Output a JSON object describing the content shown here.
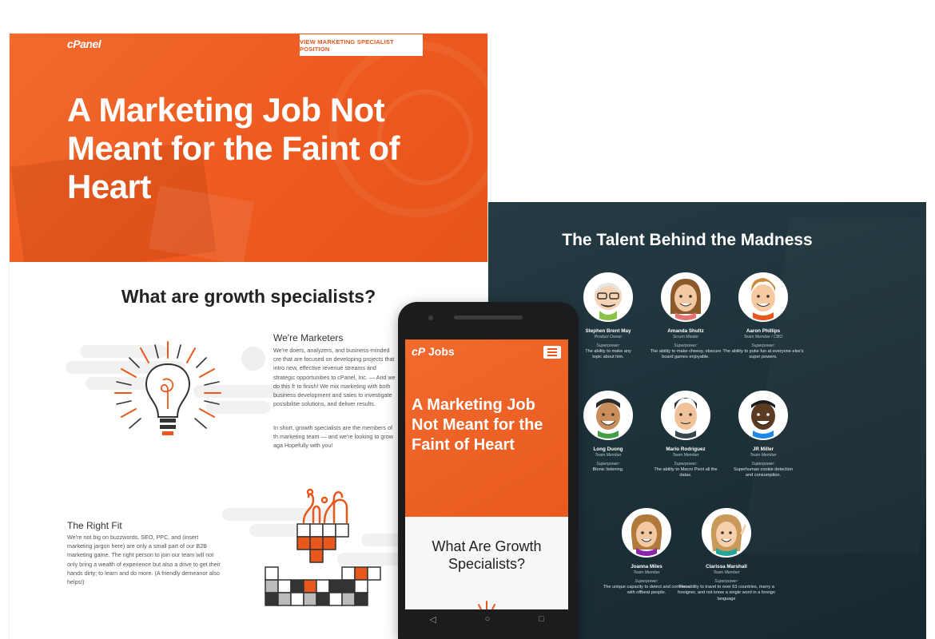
{
  "desktop": {
    "brand": "cPanel",
    "position_button": "VIEW MARKETING SPECIALIST POSITION",
    "hero_title": "A Marketing Job Not Meant for the Faint of Heart",
    "section_title": "What are growth specialists?",
    "marketers": {
      "heading": "We're Marketers",
      "paragraph1": "We're doers, analyzers, and business-minded cre that are focused on developing projects that intro new, effective revenue streams and strategic opportunities to cPanel, Inc. — And we do this fr to finish! We mix marketing with both business development and sales to investigate possibilitie solutions, and deliver results.",
      "paragraph2": "In short, growth specialists are the members of th marketing team — and we're looking to grow aga Hopefully with you!"
    },
    "right_fit": {
      "heading": "The Right Fit",
      "paragraph": "We're not big on buzzwords. SEO, PPC, and (insert marketing jargon here) are only a small part of our B2B marketing game. The right person to join our team will not only bring a wealth of experience but also a drive to get their hands dirty; to learn and do more. (A friendly demeanor also helps!)"
    },
    "accent_color": "#ee5a1f"
  },
  "talent": {
    "title": "The Talent Behind the Madness",
    "superpower_label": "Superpower:",
    "members": [
      {
        "name": "Stephen Brent May",
        "role": "Product Owner",
        "superpower": "The ability to make any topic about him."
      },
      {
        "name": "Amanda Shultz",
        "role": "Scrum Master",
        "superpower": "The ability to make cheesy, obscure board games enjoyable."
      },
      {
        "name": "Aaron Phillips",
        "role": "Team Member / CBO",
        "superpower": "The ability to poke fun at everyone else's super powers."
      },
      {
        "name": "Long Duong",
        "role": "Team Member",
        "superpower": "Bionic listening."
      },
      {
        "name": "Mario Rodriguez",
        "role": "Team Member",
        "superpower": "The ability to Macro Pivot all the datas."
      },
      {
        "name": "JR Miller",
        "role": "Team Member",
        "superpower": "Superhuman cookie detection and consumption."
      },
      {
        "name": "Joanna Miles",
        "role": "Team Member",
        "superpower": "The unique capacity to detect and converse with offbeat people."
      },
      {
        "name": "Clarissa Marshall",
        "role": "Team Member",
        "superpower": "The ability to travel to over 63 countries, marry a foreigner, and not know a single word in a foreign language"
      }
    ]
  },
  "mobile": {
    "logo": "Jobs",
    "hero_title": "A Marketing Job Not Meant for the Faint of Heart",
    "section_title": "What Are Growth Specialists?",
    "nav": {
      "back": "◁",
      "home": "○",
      "recent": "□"
    }
  }
}
